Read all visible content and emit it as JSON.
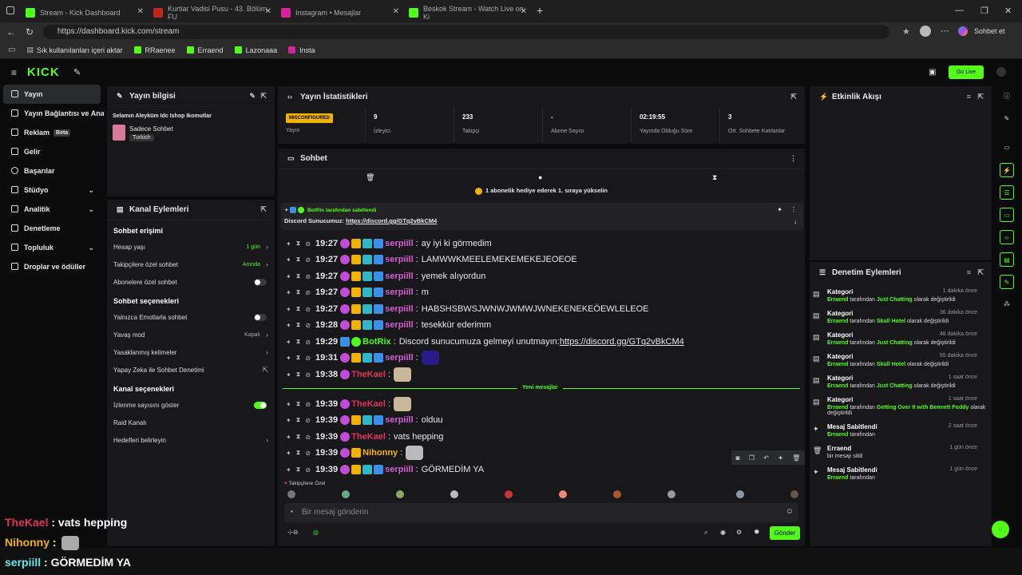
{
  "browser": {
    "tabs": [
      {
        "title": "Stream - Kick Dashboard",
        "color": "#53fc18"
      },
      {
        "title": "Kurtiar Vadisi Pusu - 43. Bölüm FU",
        "color": "#c0261f"
      },
      {
        "title": "Instagram • Mesajlar",
        "color": "#d6249f"
      },
      {
        "title": "Beskok Stream - Watch Live on Ki",
        "color": "#53fc18"
      }
    ],
    "url": "https://dashboard.kick.com/stream",
    "profile_label": "Sohbet et",
    "bookmarks": [
      "Sık kullanılanları içeri aktar",
      "RRaenee",
      "Erraend",
      "Lazonaaa",
      "Insta"
    ]
  },
  "topnav": {
    "logo": "KICK",
    "go_live": "Go Live"
  },
  "sidebar": {
    "items": [
      {
        "label": "Yayın",
        "active": true
      },
      {
        "label": "Yayın Bağlantısı ve Anahtarı"
      },
      {
        "label": "Reklam",
        "beta": "Beta"
      },
      {
        "label": "Gelir"
      },
      {
        "label": "Başarılar"
      },
      {
        "label": "Stüdyo",
        "chev": "⌄"
      },
      {
        "label": "Analitik",
        "chev": "⌄"
      },
      {
        "label": "Denetleme"
      },
      {
        "label": "Topluluk",
        "chev": "⌄"
      },
      {
        "label": "Droplar ve ödüller"
      }
    ]
  },
  "yayin_bilgisi": {
    "title": "Yayın bilgisi",
    "stream_title": "Selamın Aleyküm Idc Ishop Ikomutlar",
    "category": "Sadece Sohbet",
    "language": "Turkish"
  },
  "kanal": {
    "title": "Kanal Eylemleri",
    "s1": "Sohbet erişimi",
    "r1": {
      "label": "Hesap yaşı",
      "value": "1 gün"
    },
    "r2": {
      "label": "Takipçilere özel sohbet",
      "value": "Anında"
    },
    "r3": {
      "label": "Abonelere özel sohbet"
    },
    "s2": "Sohbet seçenekleri",
    "r4": {
      "label": "Yalnızca Emotlarla sohbet"
    },
    "r5": {
      "label": "Yavaş mod",
      "value": "Kapalı"
    },
    "r6": {
      "label": "Yasaklanmış kelimeler"
    },
    "r7": {
      "label": "Yapay Zeka ile Sohbet Denetimi"
    },
    "s3": "Kanal seçenekleri",
    "r8": {
      "label": "İzlenme sayısını göster"
    },
    "r9": {
      "label": "Raid Kanalı"
    },
    "r10": {
      "label": "Hedefleri belirleyin"
    }
  },
  "stats": {
    "title": "Yayın İstatistikleri",
    "items": [
      {
        "value": "MISCONFIGURED",
        "label": "Yayın"
      },
      {
        "value": "9",
        "label": "İzleyici"
      },
      {
        "value": "233",
        "label": "Takipçi"
      },
      {
        "value": "-",
        "label": "Abone Sayısı"
      },
      {
        "value": "02:19:55",
        "label": "Yayında Olduğu Süre"
      },
      {
        "value": "3",
        "label": "Ort. Sohbete Katılanlar"
      }
    ]
  },
  "chat": {
    "title": "Sohbet",
    "gift_banner": "1 abonelik hediye ederek 1. sıraya yükselin",
    "pinned_by": "BotRix tarafından sabitlendi",
    "pinned_text": "Discord Sunucumuz:",
    "pinned_link": "https://discord.gg/GTq2vBkCM4",
    "new_messages": "Yeni mesajlar",
    "follower_only": "Takipçilere Özel",
    "placeholder": "Bir mesaj gönderin",
    "send": "Gönder",
    "messages": [
      {
        "time": "19:27",
        "user": "serpiill",
        "color": "#d65bd6",
        "text": "ay iyi ki görmedim"
      },
      {
        "time": "19:27",
        "user": "serpiill",
        "color": "#d65bd6",
        "text": "LAMWWKMEELEMEKEMEKEJEOEOE"
      },
      {
        "time": "19:27",
        "user": "serpiill",
        "color": "#d65bd6",
        "text": "yemek alıyordun"
      },
      {
        "time": "19:27",
        "user": "serpiill",
        "color": "#d65bd6",
        "text": "m"
      },
      {
        "time": "19:27",
        "user": "serpiill",
        "color": "#d65bd6",
        "text": "HABSHSBWSJWNWJWMWJWNEKENEKEÖEWLELEOE"
      },
      {
        "time": "19:28",
        "user": "serpiill",
        "color": "#d65bd6",
        "text": "tesekkür ederimm"
      },
      {
        "time": "19:29",
        "user": "BotRix",
        "color": "#53fc18",
        "text": "Discord sunucumuza gelmeyi unutmayın:",
        "link": "https://discord.gg/GTq2vBkCM4"
      },
      {
        "time": "19:31",
        "user": "serpiill",
        "color": "#d65bd6",
        "text": ""
      },
      {
        "time": "19:38",
        "user": "TheKael",
        "color": "#e0335a",
        "text": ""
      },
      {
        "time": "19:39",
        "user": "TheKael",
        "color": "#e0335a",
        "text": ""
      },
      {
        "time": "19:39",
        "user": "serpiill",
        "color": "#d65bd6",
        "text": "olduu"
      },
      {
        "time": "19:39",
        "user": "TheKael",
        "color": "#e0335a",
        "text": "vats hepping"
      },
      {
        "time": "19:39",
        "user": "Nihonny",
        "color": "#f0b400",
        "text": ""
      },
      {
        "time": "19:39",
        "user": "serpiill",
        "color": "#d65bd6",
        "text": "GÖRMEDİM YA"
      }
    ]
  },
  "etkinlik": {
    "title": "Etkinlik Akışı"
  },
  "denetim": {
    "title": "Denetim Eylemleri",
    "items": [
      {
        "title": "Kategori",
        "user": "Erraend",
        "pre": "tarafından",
        "cat": "Just Chatting",
        "post": "olarak değiştirildi",
        "time": "1 dakika önce"
      },
      {
        "title": "Kategori",
        "user": "Erraend",
        "pre": "tarafından",
        "cat": "Skull Hotel",
        "post": "olarak değiştirildi",
        "time": "36 dakika önce"
      },
      {
        "title": "Kategori",
        "user": "Erraend",
        "pre": "tarafından",
        "cat": "Just Chatting",
        "post": "olarak değiştirildi",
        "time": "48 dakika önce"
      },
      {
        "title": "Kategori",
        "user": "Erraend",
        "pre": "tarafından",
        "cat": "Skull Hotel",
        "post": "olarak değiştirildi",
        "time": "55 dakika önce"
      },
      {
        "title": "Kategori",
        "user": "Erraend",
        "pre": "tarafından",
        "cat": "Just Chatting",
        "post": "olarak değiştirildi",
        "time": "1 saat önce"
      },
      {
        "title": "Kategori",
        "user": "Erraend",
        "pre": "tarafından",
        "cat": "Getting Over It with Bennett Foddy",
        "post": "olarak değiştirildi",
        "time": "1 saat önce"
      },
      {
        "title": "Mesaj Sabitlendi",
        "user": "Erraend",
        "pre": "tarafından",
        "cat": "",
        "post": "",
        "time": "2 saat önce"
      },
      {
        "title": "Erraend",
        "user": "",
        "pre": "bir mesajı sildi",
        "cat": "",
        "post": "",
        "time": "1 gün önce"
      },
      {
        "title": "Mesaj Sabitlendi",
        "user": "Erraend",
        "pre": "tarafından",
        "cat": "",
        "post": "",
        "time": "1 gün önce"
      }
    ]
  },
  "overlay": [
    {
      "user": "TheKael",
      "color": "#e0335a",
      "text": ": vats hepping"
    },
    {
      "user": "Nihonny",
      "color": "#f0b400",
      "text": ":"
    },
    {
      "user": "serpiill",
      "color": "#63e6e6",
      "text": ": GÖRMEDİM YA"
    }
  ]
}
